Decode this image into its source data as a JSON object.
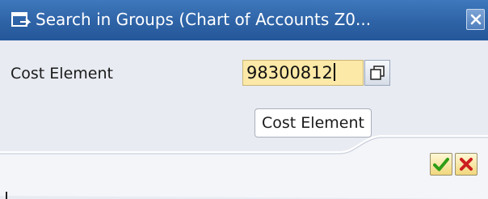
{
  "window": {
    "title": "Search in Groups (Chart of Accounts Z0...",
    "icon": "search-window-icon",
    "close_icon": "close-icon"
  },
  "form": {
    "label": "Cost Element",
    "value": "98300812",
    "multiple_selection_icon": "multiple-selection-icon"
  },
  "tooltip": {
    "text": "Cost Element"
  },
  "actions": {
    "ok_icon": "check-icon",
    "cancel_icon": "cancel-icon"
  },
  "colors": {
    "titlebar": "#2e63a6",
    "background": "#e8ebf2",
    "input_highlight": "#fde9a7",
    "ok_green": "#2e9d16",
    "cancel_red": "#cc1f1f"
  }
}
